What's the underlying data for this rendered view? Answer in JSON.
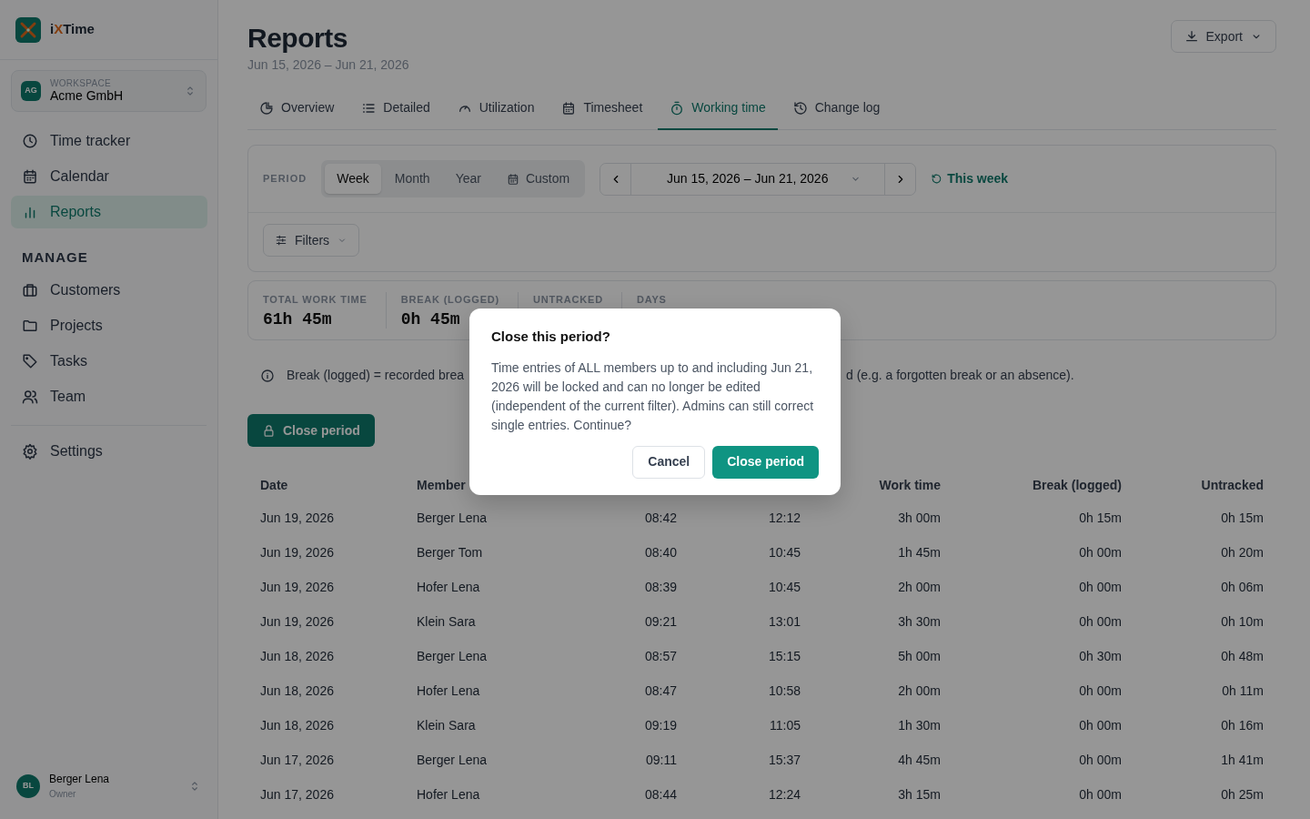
{
  "sidebar": {
    "brand": {
      "prefix": "i",
      "accent": "X",
      "suffix": "Time"
    },
    "workspace": {
      "initials": "AG",
      "label": "WORKSPACE",
      "name": "Acme GmbH"
    },
    "nav": [
      {
        "label": "Time tracker",
        "selected": false
      },
      {
        "label": "Calendar",
        "selected": false
      },
      {
        "label": "Reports",
        "selected": true
      }
    ],
    "manage_heading": "MANAGE",
    "manage": [
      {
        "label": "Customers",
        "selected": false
      },
      {
        "label": "Projects",
        "selected": false
      },
      {
        "label": "Tasks",
        "selected": false
      },
      {
        "label": "Team",
        "selected": false
      }
    ],
    "settings": {
      "label": "Settings",
      "selected": false
    },
    "user": {
      "initials": "BL",
      "name": "Berger Lena",
      "role": "Owner"
    }
  },
  "header": {
    "title": "Reports",
    "subtitle": "Jun 15, 2026 – Jun 21, 2026",
    "export": "Export"
  },
  "tabs": [
    {
      "label": "Overview",
      "selected": false
    },
    {
      "label": "Detailed",
      "selected": false
    },
    {
      "label": "Utilization",
      "selected": false
    },
    {
      "label": "Timesheet",
      "selected": false
    },
    {
      "label": "Working time",
      "selected": true
    },
    {
      "label": "Change log",
      "selected": false
    }
  ],
  "period": {
    "label": "PERIOD",
    "options": [
      {
        "label": "Week",
        "selected": true
      },
      {
        "label": "Month",
        "selected": false
      },
      {
        "label": "Year",
        "selected": false
      },
      {
        "label": "Custom",
        "selected": false
      }
    ],
    "range": "Jun 15, 2026 – Jun 21, 2026",
    "reset": "This week",
    "filters": "Filters"
  },
  "stats": [
    {
      "label": "TOTAL WORK TIME",
      "value": "61h 45m"
    },
    {
      "label": "BREAK (LOGGED)",
      "value": "0h 45m"
    },
    {
      "label": "UNTRACKED"
    },
    {
      "label": "DAYS"
    }
  ],
  "info": {
    "left": "Break (logged) = recorded brea",
    "right": "d (e.g. a forgotten break or an absence)."
  },
  "close_button": "Close period",
  "table": {
    "columns": [
      "Date",
      "Member",
      "",
      "",
      "Work time",
      "Break (logged)",
      "Untracked"
    ],
    "rows": [
      [
        "Jun 19, 2026",
        "Berger Lena",
        "08:42",
        "12:12",
        "3h 00m",
        "0h 15m",
        "0h 15m"
      ],
      [
        "Jun 19, 2026",
        "Berger Tom",
        "08:40",
        "10:45",
        "1h 45m",
        "0h 00m",
        "0h 20m"
      ],
      [
        "Jun 19, 2026",
        "Hofer Lena",
        "08:39",
        "10:45",
        "2h 00m",
        "0h 00m",
        "0h 06m"
      ],
      [
        "Jun 19, 2026",
        "Klein Sara",
        "09:21",
        "13:01",
        "3h 30m",
        "0h 00m",
        "0h 10m"
      ],
      [
        "Jun 18, 2026",
        "Berger Lena",
        "08:57",
        "15:15",
        "5h 00m",
        "0h 30m",
        "0h 48m"
      ],
      [
        "Jun 18, 2026",
        "Hofer Lena",
        "08:47",
        "10:58",
        "2h 00m",
        "0h 00m",
        "0h 11m"
      ],
      [
        "Jun 18, 2026",
        "Klein Sara",
        "09:19",
        "11:05",
        "1h 30m",
        "0h 00m",
        "0h 16m"
      ],
      [
        "Jun 17, 2026",
        "Berger Lena",
        "09:11",
        "15:37",
        "4h 45m",
        "0h 00m",
        "1h 41m"
      ],
      [
        "Jun 17, 2026",
        "Hofer Lena",
        "08:44",
        "12:24",
        "3h 15m",
        "0h 00m",
        "0h 25m"
      ]
    ]
  },
  "dialog": {
    "title": "Close this period?",
    "body": "Time entries of ALL members up to and including Jun 21, 2026 will be locked and can no longer be edited (independent of the current filter). Admins can still correct single entries. Continue?",
    "buttons": [
      {
        "label": "Cancel",
        "kind": "secondary"
      },
      {
        "label": "Close period",
        "kind": "primary"
      }
    ]
  }
}
